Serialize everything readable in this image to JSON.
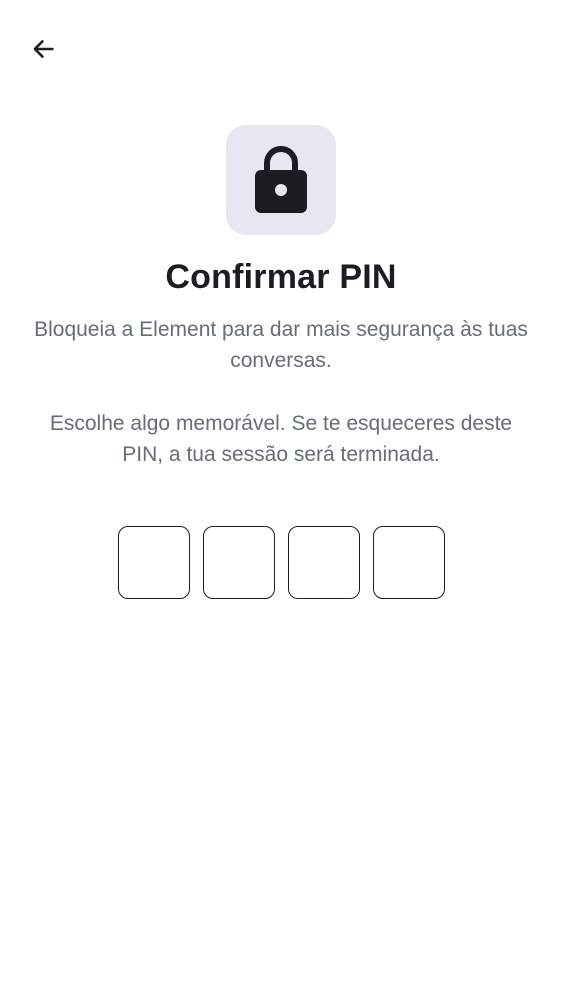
{
  "header": {
    "back_icon": "arrow-left-icon"
  },
  "hero": {
    "icon": "lock-icon",
    "tile_color": "#e5e8f0"
  },
  "title": "Confirmar PIN",
  "description": {
    "line1": "Bloqueia a Element para dar mais segurança às tuas conversas.",
    "line2": "Escolhe algo memorável. Se te esqueceres deste PIN, a tua sessão será terminada."
  },
  "pin": {
    "length": 4,
    "digits": [
      "",
      "",
      "",
      ""
    ]
  }
}
